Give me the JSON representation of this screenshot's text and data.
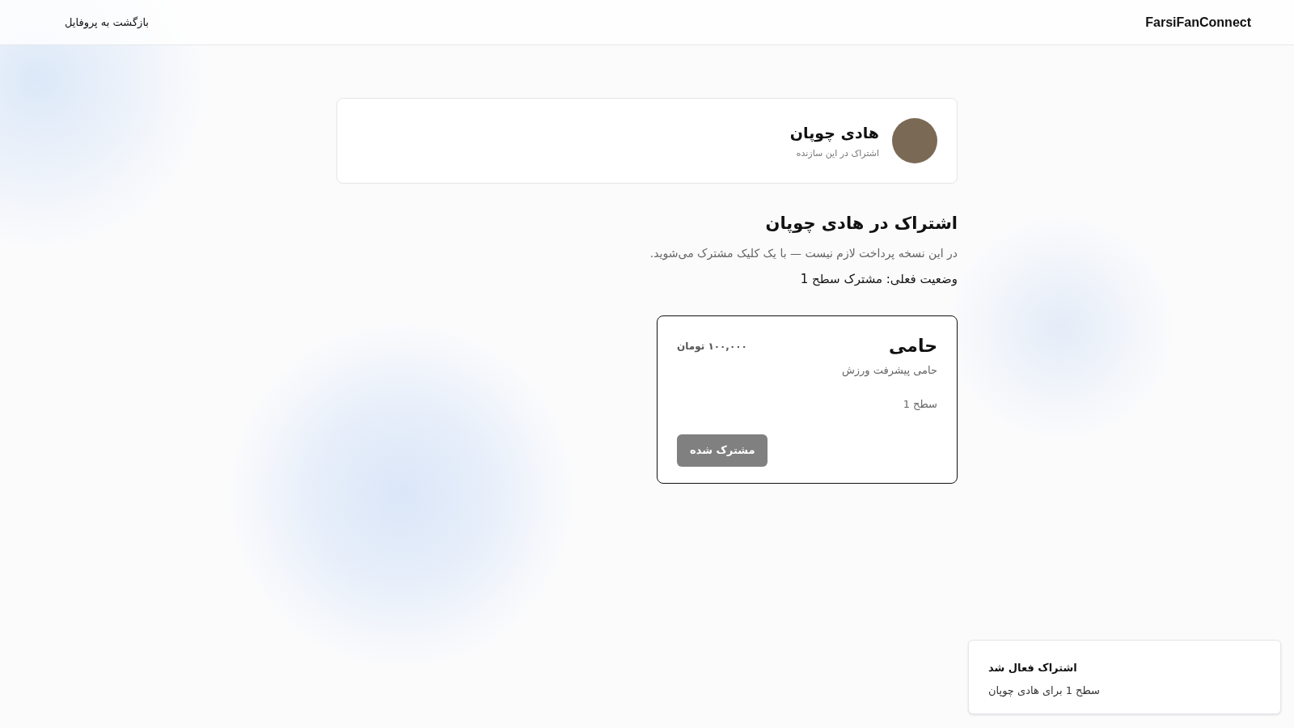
{
  "header": {
    "brand": "FarsiFanConnect",
    "back_link": "بازگشت به پروفایل"
  },
  "creator_card": {
    "name": "هادی چوپان",
    "subtitle": "اشتراک در این سازنده"
  },
  "intro": {
    "title": "اشتراک در هادی چوپان",
    "note": "در این نسخه پرداخت لازم نیست — با یک کلیک مشترک می‌شوید.",
    "status": "وضعیت فعلی: مشترک سطح 1"
  },
  "plans": [
    {
      "name": "حامی",
      "price": "۱۰۰,۰۰۰ تومان",
      "description": "حامی پیشرفت ورزش",
      "tier": "سطح 1",
      "button": "مشترک شده",
      "subscribed": true
    }
  ],
  "toast": {
    "title": "اشتراک فعال شد",
    "message": "سطح 1 برای هادی چوپان"
  }
}
